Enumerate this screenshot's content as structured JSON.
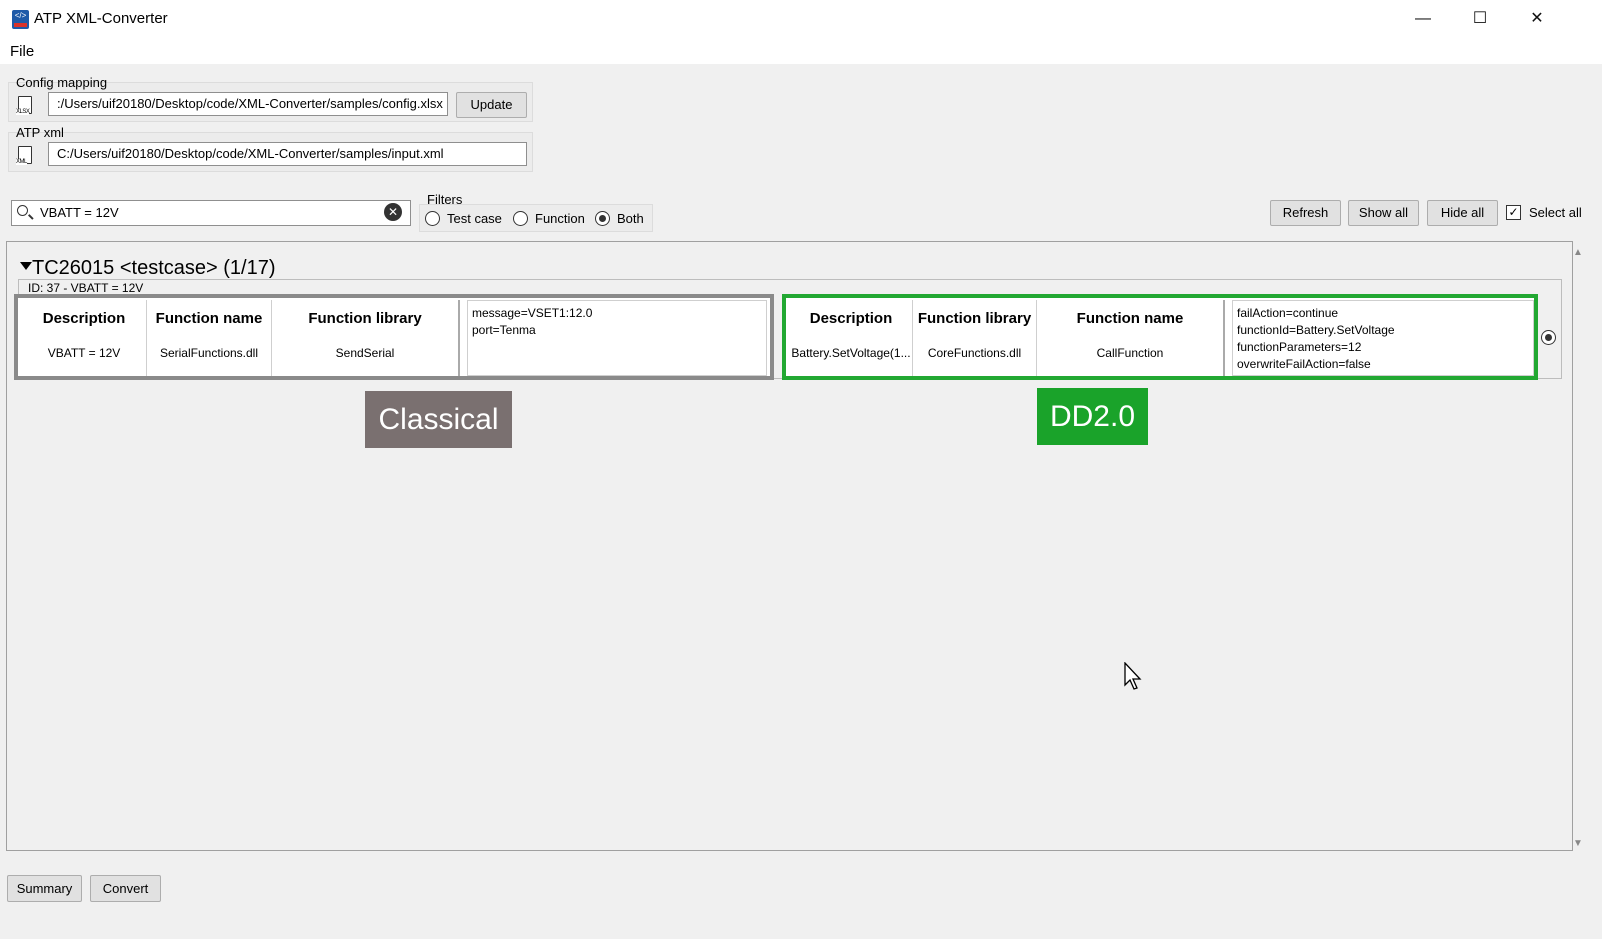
{
  "window": {
    "title": "ATP XML-Converter",
    "minimize": "—",
    "maximize": "☐",
    "close": "✕"
  },
  "menu": {
    "file": "File"
  },
  "config": {
    "label": "Config mapping",
    "path": ":/Users/uif20180/Desktop/code/XML-Converter/samples/config.xlsx",
    "icon_text": "XLSX",
    "update": "Update"
  },
  "atp": {
    "label": "ATP xml",
    "path": "C:/Users/uif20180/Desktop/code/XML-Converter/samples/input.xml",
    "icon_text": "XML"
  },
  "search": {
    "value": "VBATT = 12V"
  },
  "filters": {
    "label": "Filters",
    "options": [
      "Test case",
      "Function",
      "Both"
    ],
    "selected": "Both"
  },
  "toolbar": {
    "refresh": "Refresh",
    "show_all": "Show all",
    "hide_all": "Hide all",
    "select_all": "Select all"
  },
  "testcase": {
    "header": "TC26015 <testcase> (1/17)",
    "id_line": "ID: 37 - VBATT = 12V",
    "classical": {
      "columns": [
        {
          "header": "Description",
          "value": "VBATT = 12V"
        },
        {
          "header": "Function name",
          "value": "SerialFunctions.dll"
        },
        {
          "header": "Function library",
          "value": "SendSerial"
        }
      ],
      "params": [
        "message=VSET1:12.0",
        "port=Tenma"
      ],
      "tag": "Classical"
    },
    "dd2": {
      "columns": [
        {
          "header": "Description",
          "value": "Battery.SetVoltage(1..."
        },
        {
          "header": "Function library",
          "value": "CoreFunctions.dll"
        },
        {
          "header": "Function name",
          "value": "CallFunction"
        }
      ],
      "params": [
        "failAction=continue",
        "functionId=Battery.SetVoltage",
        "functionParameters=12",
        "overwriteFailAction=false"
      ],
      "tag": "DD2.0"
    }
  },
  "bottom": {
    "summary": "Summary",
    "convert": "Convert"
  },
  "colors": {
    "classical_border": "#8a8a8a",
    "dd2_border": "#22a832",
    "classical_tag": "#7a7070",
    "dd2_tag": "#1aa32a"
  }
}
